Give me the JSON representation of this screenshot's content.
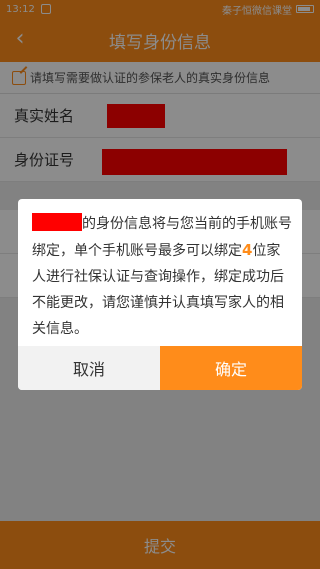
{
  "status_bar": {
    "time": "13:12",
    "carrier": "秦子恒微信课堂"
  },
  "nav": {
    "title": "填写身份信息",
    "back_icon": "chevron-left-icon"
  },
  "tip": {
    "text": "请填写需要做认证的参保老人的真实身份信息"
  },
  "form": {
    "name_label": "真实姓名",
    "id_label": "身份证号"
  },
  "dialog": {
    "message_part1": "的身份信息将与您当前的手机账号绑定，单个手机账号最多可以绑定",
    "highlight_count": "4",
    "message_part2": "位家人进行社保认证与查询操作，绑定成功后不能更改，请您谨慎并认真填写家人的相关信息。",
    "cancel_label": "取消",
    "confirm_label": "确定"
  },
  "submit": {
    "label": "提交"
  },
  "colors": {
    "accent": "#ff8c1a",
    "redaction": "#ff0000"
  }
}
